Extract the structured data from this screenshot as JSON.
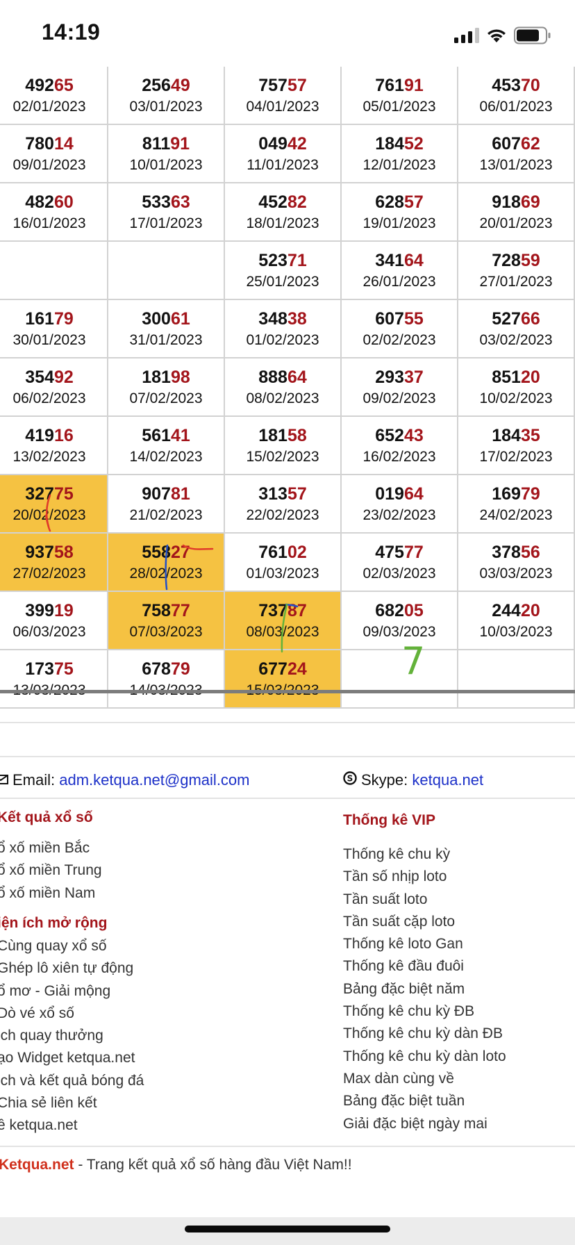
{
  "status_bar": {
    "time": "14:19",
    "battery_level": 0.8
  },
  "grid": {
    "rows": [
      [
        {
          "head": "492",
          "tail": "65",
          "date": "02/01/2023"
        },
        {
          "head": "256",
          "tail": "49",
          "date": "03/01/2023"
        },
        {
          "head": "757",
          "tail": "57",
          "date": "04/01/2023"
        },
        {
          "head": "761",
          "tail": "91",
          "date": "05/01/2023"
        },
        {
          "head": "453",
          "tail": "70",
          "date": "06/01/2023"
        }
      ],
      [
        {
          "head": "780",
          "tail": "14",
          "date": "09/01/2023"
        },
        {
          "head": "811",
          "tail": "91",
          "date": "10/01/2023"
        },
        {
          "head": "049",
          "tail": "42",
          "date": "11/01/2023"
        },
        {
          "head": "184",
          "tail": "52",
          "date": "12/01/2023"
        },
        {
          "head": "607",
          "tail": "62",
          "date": "13/01/2023"
        }
      ],
      [
        {
          "head": "482",
          "tail": "60",
          "date": "16/01/2023"
        },
        {
          "head": "533",
          "tail": "63",
          "date": "17/01/2023"
        },
        {
          "head": "452",
          "tail": "82",
          "date": "18/01/2023"
        },
        {
          "head": "628",
          "tail": "57",
          "date": "19/01/2023"
        },
        {
          "head": "918",
          "tail": "69",
          "date": "20/01/2023"
        }
      ],
      [
        {
          "head": "",
          "tail": "",
          "date": ""
        },
        {
          "head": "",
          "tail": "",
          "date": ""
        },
        {
          "head": "523",
          "tail": "71",
          "date": "25/01/2023"
        },
        {
          "head": "341",
          "tail": "64",
          "date": "26/01/2023"
        },
        {
          "head": "728",
          "tail": "59",
          "date": "27/01/2023"
        }
      ],
      [
        {
          "head": "161",
          "tail": "79",
          "date": "30/01/2023"
        },
        {
          "head": "300",
          "tail": "61",
          "date": "31/01/2023"
        },
        {
          "head": "348",
          "tail": "38",
          "date": "01/02/2023"
        },
        {
          "head": "607",
          "tail": "55",
          "date": "02/02/2023"
        },
        {
          "head": "527",
          "tail": "66",
          "date": "03/02/2023"
        }
      ],
      [
        {
          "head": "354",
          "tail": "92",
          "date": "06/02/2023"
        },
        {
          "head": "181",
          "tail": "98",
          "date": "07/02/2023"
        },
        {
          "head": "888",
          "tail": "64",
          "date": "08/02/2023"
        },
        {
          "head": "293",
          "tail": "37",
          "date": "09/02/2023"
        },
        {
          "head": "851",
          "tail": "20",
          "date": "10/02/2023"
        }
      ],
      [
        {
          "head": "419",
          "tail": "16",
          "date": "13/02/2023"
        },
        {
          "head": "561",
          "tail": "41",
          "date": "14/02/2023"
        },
        {
          "head": "181",
          "tail": "58",
          "date": "15/02/2023"
        },
        {
          "head": "652",
          "tail": "43",
          "date": "16/02/2023"
        },
        {
          "head": "184",
          "tail": "35",
          "date": "17/02/2023"
        }
      ],
      [
        {
          "head": "327",
          "tail": "75",
          "date": "20/02/2023",
          "hl": true
        },
        {
          "head": "907",
          "tail": "81",
          "date": "21/02/2023"
        },
        {
          "head": "313",
          "tail": "57",
          "date": "22/02/2023"
        },
        {
          "head": "019",
          "tail": "64",
          "date": "23/02/2023"
        },
        {
          "head": "169",
          "tail": "79",
          "date": "24/02/2023"
        }
      ],
      [
        {
          "head": "937",
          "tail": "58",
          "date": "27/02/2023",
          "hl": true
        },
        {
          "head": "558",
          "tail": "27",
          "date": "28/02/2023",
          "hl": true
        },
        {
          "head": "761",
          "tail": "02",
          "date": "01/03/2023"
        },
        {
          "head": "475",
          "tail": "77",
          "date": "02/03/2023"
        },
        {
          "head": "378",
          "tail": "56",
          "date": "03/03/2023"
        }
      ],
      [
        {
          "head": "399",
          "tail": "19",
          "date": "06/03/2023"
        },
        {
          "head": "758",
          "tail": "77",
          "date": "07/03/2023",
          "hl": true
        },
        {
          "head": "737",
          "tail": "87",
          "date": "08/03/2023",
          "hl": true
        },
        {
          "head": "682",
          "tail": "05",
          "date": "09/03/2023"
        },
        {
          "head": "244",
          "tail": "20",
          "date": "10/03/2023"
        }
      ],
      [
        {
          "head": "173",
          "tail": "75",
          "date": "13/03/2023"
        },
        {
          "head": "678",
          "tail": "79",
          "date": "14/03/2023"
        },
        {
          "head": "677",
          "tail": "24",
          "date": "15/03/2023",
          "hl": true
        },
        {
          "head": "",
          "tail": "",
          "date": ""
        },
        {
          "head": "",
          "tail": "",
          "date": ""
        }
      ]
    ]
  },
  "handwritten_note": "7",
  "contact": {
    "email_label": "Email:",
    "email": "adm.ketqua.net@gmail.com",
    "skype_label": "Skype:",
    "skype": "ketqua.net"
  },
  "footer": {
    "left_heading_1": "Kết quả xổ số",
    "left_items_1": [
      "ổ xố miền Bắc",
      "ổ xố miền Trung",
      "ổ xố miền Nam"
    ],
    "left_heading_2": "iện ích mở rộng",
    "left_items_2": [
      "Cùng quay xổ số",
      "Ghép lô xiên tự động",
      "ổ mơ - Giải mộng",
      "Dò vé xổ số",
      "ịch quay thưởng",
      "ạo Widget ketqua.net",
      "ịch và kết quả bóng đá",
      "Chia sẻ liên kết",
      "ề ketqua.net"
    ],
    "right_heading": "Thống kê VIP",
    "right_items": [
      "Thống kê chu kỳ",
      "Tần số nhịp loto",
      "Tần suất loto",
      "Tần suất cặp loto",
      "Thống kê loto Gan",
      "Thống kê đầu đuôi",
      "Bảng đặc biệt năm",
      "Thống kê chu kỳ ĐB",
      "Thống kê chu kỳ dàn ĐB",
      "Thống kê chu kỳ dàn loto",
      "Max dàn cùng về",
      "Bảng đặc biệt tuần",
      "Giải đặc biệt ngày mai"
    ],
    "site_name": "Ketqua.net",
    "site_tagline": " - Trang kết quả xổ số hàng đầu Việt Nam!!"
  },
  "colors": {
    "highlight": "#f5c242",
    "tail": "#a3151b",
    "link": "#1c30c8",
    "heading": "#a3151b"
  }
}
